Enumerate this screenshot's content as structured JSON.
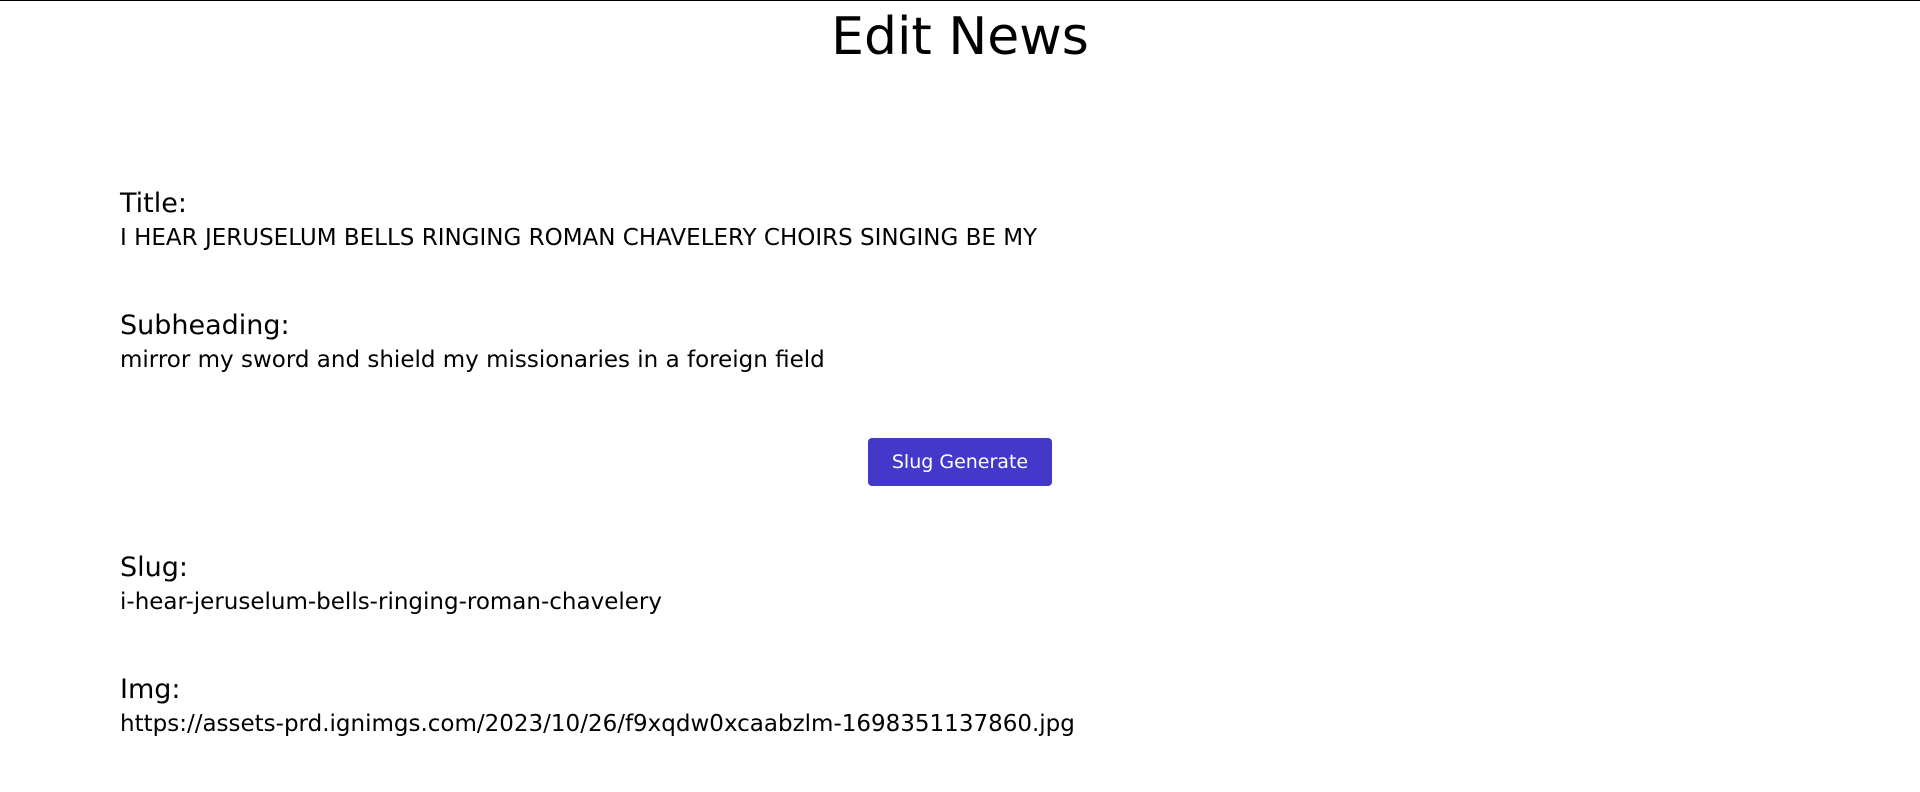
{
  "page": {
    "title": "Edit News"
  },
  "form": {
    "title_label": "Title:",
    "title_value": "I HEAR JERUSELUM BELLS RINGING ROMAN CHAVELERY CHOIRS SINGING BE MY",
    "subheading_label": "Subheading:",
    "subheading_value": "mirror my sword and shield my missionaries in a foreign field",
    "slug_button_label": "Slug Generate",
    "slug_label": "Slug:",
    "slug_value": "i-hear-jeruselum-bells-ringing-roman-chavelery",
    "img_label": "Img:",
    "img_value": "https://assets-prd.ignimgs.com/2023/10/26/f9xqdw0xcaabzlm-1698351137860.jpg"
  },
  "colors": {
    "button_bg": "#4338ca",
    "button_text": "#ffffff",
    "text": "#000000",
    "background": "#ffffff"
  }
}
